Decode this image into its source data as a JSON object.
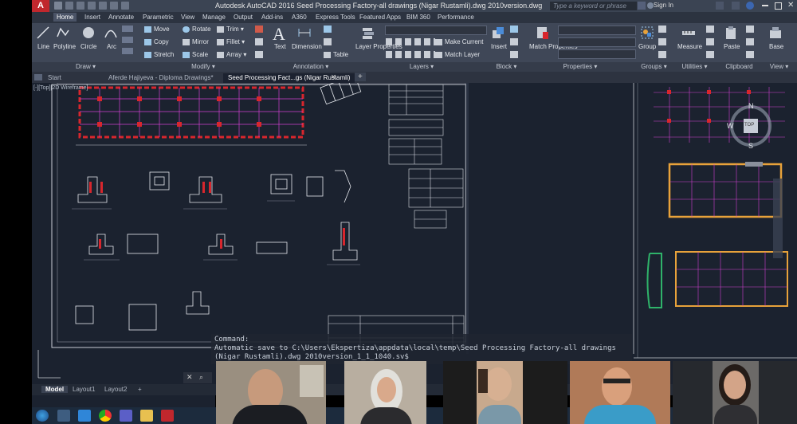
{
  "window": {
    "title": "Autodesk AutoCAD 2016   Seed Processing Factory-all drawings (Nigar Rustamli).dwg 2010version.dwg",
    "search_placeholder": "Type a keyword or phrase",
    "sign_in": "Sign In"
  },
  "ribbon_tabs": [
    "Home",
    "Insert",
    "Annotate",
    "Parametric",
    "View",
    "Manage",
    "Output",
    "Add-ins",
    "A360",
    "Express Tools",
    "Featured Apps",
    "BIM 360",
    "Performance"
  ],
  "draw": {
    "line": "Line",
    "polyline": "Polyline",
    "circle": "Circle",
    "arc": "Arc",
    "title": "Draw ▾"
  },
  "modify": {
    "move": "Move",
    "rotate": "Rotate",
    "trim": "Trim ▾",
    "copy": "Copy",
    "mirror": "Mirror",
    "fillet": "Fillet ▾",
    "stretch": "Stretch",
    "scale": "Scale",
    "array": "Array ▾",
    "title": "Modify ▾"
  },
  "annotation": {
    "text": "Text",
    "dimension": "Dimension",
    "table": "Table",
    "title": "Annotation ▾"
  },
  "layers": {
    "layer_properties": "Layer Properties",
    "make_current": "Make Current",
    "match_layer": "Match Layer",
    "title": "Layers ▾"
  },
  "block": {
    "insert": "Insert",
    "title": "Block ▾"
  },
  "properties": {
    "match_properties": "Match Properties",
    "title": "Properties ▾"
  },
  "groups": {
    "group": "Group",
    "title": "Groups ▾"
  },
  "utilities": {
    "measure": "Measure",
    "title": "Utilities ▾"
  },
  "clipboard": {
    "paste": "Paste",
    "title": "Clipboard"
  },
  "view_panel": {
    "base": "Base",
    "title": "View ▾"
  },
  "file_tabs": [
    "Start",
    "Aferde Hajiyeva - Diploma Drawings*",
    "Seed Processing Fact...gs (Nigar Rustamli)"
  ],
  "viewport_label": "[-][Top][2D Wireframe]",
  "navcube": {
    "north": "N",
    "south": "S",
    "west": "W",
    "face": "TOP"
  },
  "command": {
    "label": "Command:",
    "line1": "Automatic save to C:\\Users\\Ekspertiza\\appdata\\local\\temp\\Seed Processing Factory-all drawings",
    "line2": "(Nigar Rustamli).dwg 2010version_1_1_1040.sv$"
  },
  "layout_tabs": [
    "Model",
    "Layout1",
    "Layout2",
    "+"
  ],
  "colors": {
    "canvas": "#1b222f",
    "ribbon": "#3f4757",
    "accent_red": "#d8262d",
    "magenta": "#d040d0",
    "orange": "#e8a23a"
  }
}
